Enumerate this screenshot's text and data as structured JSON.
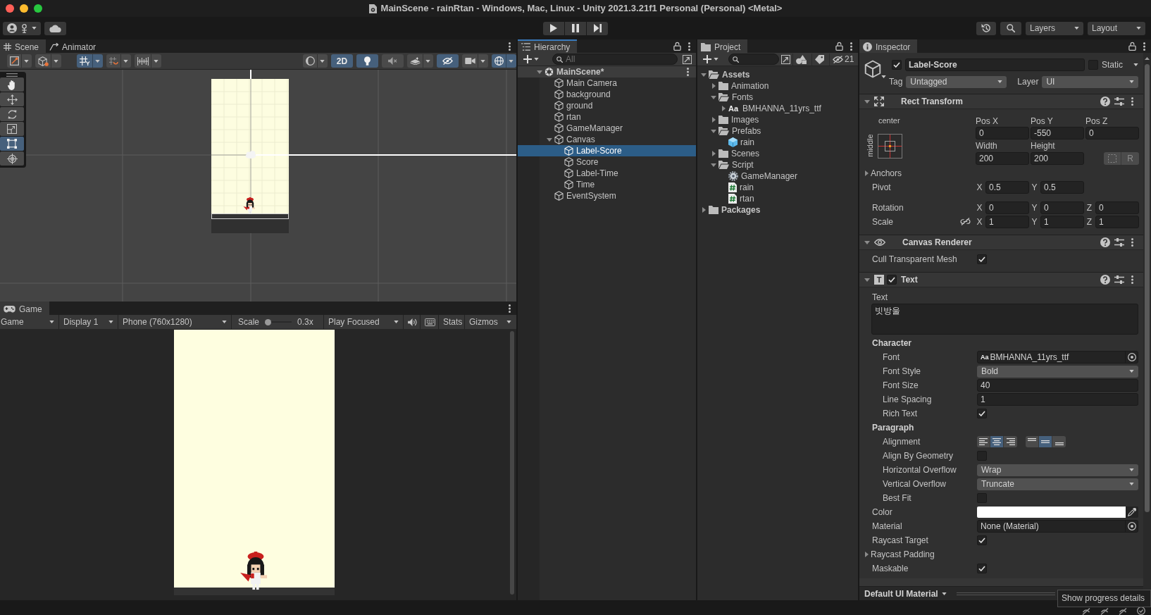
{
  "window": {
    "title": "MainScene - rainRtan - Windows, Mac, Linux - Unity 2021.3.21f1 Personal (Personal) <Metal>"
  },
  "toolbar": {
    "play_controls": [
      {
        "kind": "play",
        "on": false
      },
      {
        "kind": "pause",
        "on": false
      },
      {
        "kind": "step",
        "on": false
      }
    ],
    "layers": "Layers",
    "layout": "Layout"
  },
  "scene_panel": {
    "tabs": [
      {
        "kind": "scene",
        "label": "Scene",
        "selected": true
      },
      {
        "kind": "animator",
        "label": "Animator",
        "selected": false
      }
    ],
    "toolbar_left": [
      {
        "kind": "draw_mode",
        "on": false,
        "menu": true
      },
      {
        "kind": "shading",
        "on": false,
        "menu": true
      },
      {
        "kind": "grid_snap",
        "on": true,
        "menu": true
      },
      {
        "kind": "increment_snap",
        "on": false,
        "menu": true
      },
      {
        "kind": "grid",
        "on": false,
        "menu": true
      }
    ],
    "toolbar_right": [
      {
        "kind": "orientation",
        "on": false,
        "menu": true
      },
      {
        "kind": "mode_2d",
        "label": "2D",
        "on": true,
        "menu": false
      },
      {
        "kind": "lighting",
        "on": true,
        "menu": false
      },
      {
        "kind": "audio",
        "on": false,
        "menu": false
      },
      {
        "kind": "effects",
        "on": false,
        "menu": true
      },
      {
        "kind": "visibility",
        "on": true,
        "menu": false
      },
      {
        "kind": "camera",
        "on": false,
        "menu": true
      },
      {
        "kind": "gizmos",
        "on": true,
        "menu": true
      }
    ],
    "tools": [
      {
        "kind": "hand",
        "selected": false
      },
      {
        "kind": "move",
        "selected": false
      },
      {
        "kind": "rotate",
        "selected": false
      },
      {
        "kind": "scale",
        "selected": false
      },
      {
        "kind": "rect",
        "selected": true
      },
      {
        "kind": "transform",
        "selected": false
      }
    ]
  },
  "game_panel": {
    "tab": "Game",
    "mode": "Game",
    "display": "Display 1",
    "resolution": "Phone (760x1280)",
    "scale_label": "Scale",
    "scale_slider": {
      "level": 0
    },
    "scale_reading": "0.3x",
    "play_mode": "Play Focused",
    "stats": "Stats",
    "gizmos": "Gizmos"
  },
  "hierarchy": {
    "title": "Hierarchy",
    "focused": true,
    "search_placeholder": "All",
    "tree": [
      {
        "label": "MainScene*",
        "kind": "scene",
        "expanded": true,
        "selected": false,
        "children": [
          {
            "label": "Main Camera",
            "kind": "object",
            "selected": false
          },
          {
            "label": "background",
            "kind": "object",
            "selected": false
          },
          {
            "label": "ground",
            "kind": "object",
            "selected": false
          },
          {
            "label": "rtan",
            "kind": "object",
            "selected": false
          },
          {
            "label": "GameManager",
            "kind": "object",
            "selected": false
          },
          {
            "label": "Canvas",
            "kind": "object",
            "expanded": true,
            "selected": false,
            "children": [
              {
                "label": "Label-Score",
                "kind": "object",
                "selected": true
              },
              {
                "label": "Score",
                "kind": "object",
                "selected": false
              },
              {
                "label": "Label-Time",
                "kind": "object",
                "selected": false
              },
              {
                "label": "Time",
                "kind": "object",
                "selected": false
              }
            ]
          },
          {
            "label": "EventSystem",
            "kind": "object",
            "selected": false
          }
        ]
      }
    ]
  },
  "project": {
    "title": "Project",
    "hidden_count": "21",
    "tree": [
      {
        "label": "Assets",
        "kind": "folder",
        "expanded": true,
        "children": [
          {
            "label": "Animation",
            "kind": "folder",
            "expanded": false
          },
          {
            "label": "Fonts",
            "kind": "folder",
            "expanded": true,
            "children": [
              {
                "label": "BMHANNA_11yrs_ttf",
                "kind": "font",
                "badge": "Aa",
                "expanded": false
              }
            ]
          },
          {
            "label": "Images",
            "kind": "folder",
            "expanded": false
          },
          {
            "label": "Prefabs",
            "kind": "folder",
            "expanded": true,
            "children": [
              {
                "label": "rain",
                "kind": "prefab"
              }
            ]
          },
          {
            "label": "Scenes",
            "kind": "folder",
            "expanded": false
          },
          {
            "label": "Script",
            "kind": "folder",
            "expanded": true,
            "children": [
              {
                "label": "GameManager",
                "kind": "gear_script"
              },
              {
                "label": "rain",
                "kind": "script"
              },
              {
                "label": "rtan",
                "kind": "script"
              }
            ]
          }
        ]
      },
      {
        "label": "Packages",
        "kind": "folder",
        "expanded": false
      }
    ]
  },
  "inspector": {
    "title": "Inspector",
    "object": {
      "active": true,
      "name": "Label-Score",
      "static": false,
      "static_label": "Static",
      "tag_label": "Tag",
      "tag": "Untagged",
      "layer_label": "Layer",
      "layer": "UI"
    },
    "rect_transform": {
      "title": "Rect Transform",
      "expanded": true,
      "anchor_h": "center",
      "anchor_v": "middle",
      "position": [
        {
          "label": "Pos X",
          "value": "0"
        },
        {
          "label": "Pos Y",
          "value": "-550"
        },
        {
          "label": "Pos Z",
          "value": "0"
        }
      ],
      "size": [
        {
          "label": "Width",
          "value": "200"
        },
        {
          "label": "Height",
          "value": "200"
        }
      ],
      "raw_edit_label": "R",
      "anchors": {
        "label": "Anchors",
        "expanded": false
      },
      "pivot": {
        "label": "Pivot",
        "axes": [
          {
            "axis": "X",
            "value": "0.5"
          },
          {
            "axis": "Y",
            "value": "0.5"
          }
        ]
      },
      "rotation": {
        "label": "Rotation",
        "axes": [
          {
            "axis": "X",
            "value": "0"
          },
          {
            "axis": "Y",
            "value": "0"
          },
          {
            "axis": "Z",
            "value": "0"
          }
        ]
      },
      "scale": {
        "label": "Scale",
        "linked": false,
        "axes": [
          {
            "axis": "X",
            "value": "1"
          },
          {
            "axis": "Y",
            "value": "1"
          },
          {
            "axis": "Z",
            "value": "1"
          }
        ]
      }
    },
    "canvas_renderer": {
      "title": "Canvas Renderer",
      "expanded": true,
      "rows": [
        {
          "kind": "checkbox",
          "label": "Cull Transparent Mesh",
          "checked": true
        }
      ]
    },
    "text_component": {
      "title": "Text",
      "expanded": true,
      "enabled": true,
      "icon_glyph": "T",
      "text_label": "Text",
      "text": "빗방울",
      "rows": [
        {
          "kind": "group",
          "label": "Character",
          "children": [
            {
              "kind": "object",
              "label": "Font",
              "badge": "Aa",
              "value": "BMHANNA_11yrs_ttf"
            },
            {
              "kind": "dropdown",
              "label": "Font Style",
              "value": "Bold"
            },
            {
              "kind": "number",
              "label": "Font Size",
              "value": "40"
            },
            {
              "kind": "number",
              "label": "Line Spacing",
              "value": "1"
            },
            {
              "kind": "checkbox",
              "label": "Rich Text",
              "checked": true
            }
          ]
        },
        {
          "kind": "group",
          "label": "Paragraph",
          "children": [
            {
              "kind": "alignment",
              "label": "Alignment",
              "horizontal": [
                {
                  "selected": false
                },
                {
                  "selected": true
                },
                {
                  "selected": false
                }
              ],
              "vertical": [
                {
                  "selected": false
                },
                {
                  "selected": true
                },
                {
                  "selected": false
                }
              ]
            },
            {
              "kind": "checkbox",
              "label": "Align By Geometry",
              "checked": false
            },
            {
              "kind": "dropdown",
              "label": "Horizontal Overflow",
              "value": "Wrap"
            },
            {
              "kind": "dropdown",
              "label": "Vertical Overflow",
              "value": "Truncate"
            },
            {
              "kind": "checkbox",
              "label": "Best Fit",
              "checked": false
            }
          ]
        },
        {
          "kind": "color",
          "label": "Color",
          "color": "#ffffff"
        },
        {
          "kind": "object",
          "label": "Material",
          "value": "None (Material)"
        },
        {
          "kind": "checkbox",
          "label": "Raycast Target",
          "checked": true
        },
        {
          "kind": "foldout",
          "label": "Raycast Padding",
          "expanded": false
        },
        {
          "kind": "checkbox",
          "label": "Maskable",
          "checked": true
        }
      ]
    },
    "footer": {
      "material": "Default UI Material"
    }
  },
  "tooltip": "Show progress details"
}
